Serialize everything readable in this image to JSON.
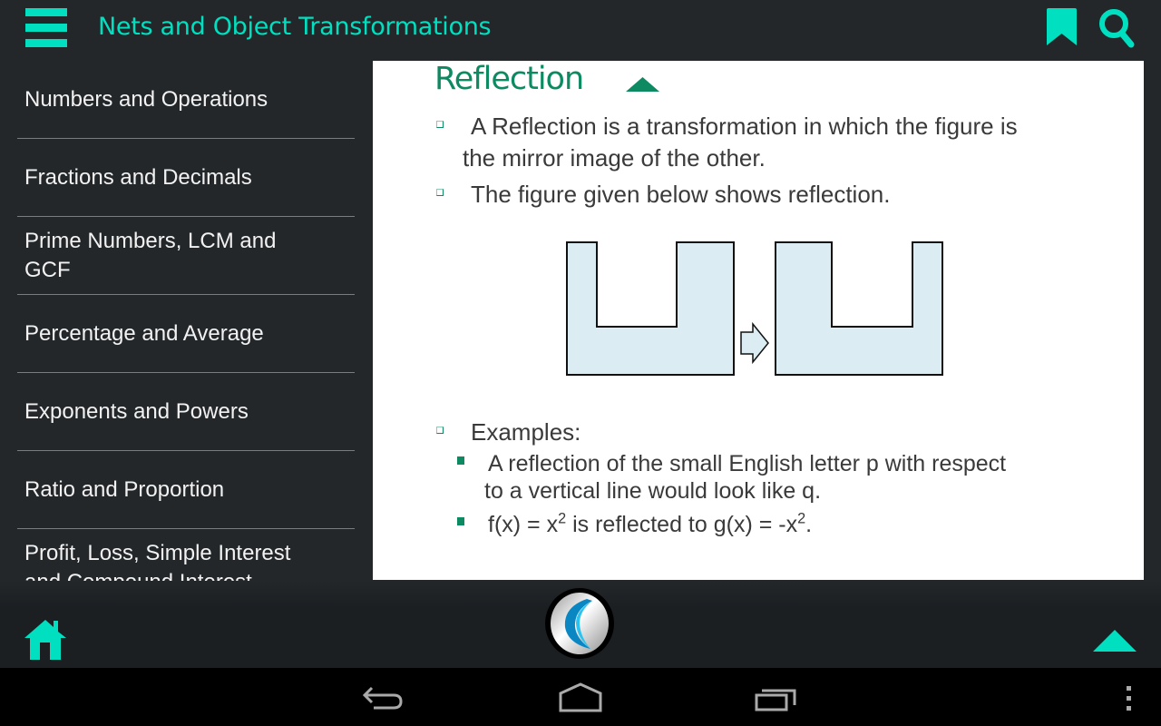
{
  "app_bar": {
    "title": "Nets and Object Transformations",
    "icons": [
      "menu-icon",
      "bookmark-icon",
      "search-icon"
    ],
    "accent_color": "#00e0c0"
  },
  "sidebar": {
    "items": [
      {
        "label": "Numbers and Operations"
      },
      {
        "label": "Fractions and Decimals"
      },
      {
        "label": "Prime Numbers, LCM and GCF"
      },
      {
        "label": "Percentage and Average"
      },
      {
        "label": "Exponents and Powers"
      },
      {
        "label": "Ratio and Proportion"
      },
      {
        "label": "Profit, Loss, Simple Interest and Compound Interest"
      }
    ]
  },
  "content": {
    "section_title": "Reflection",
    "title_color": "#0e8a62",
    "bullets": [
      {
        "line1": "A Reflection is a transformation in which the figure is",
        "line2": "the mirror image of the other."
      },
      {
        "line1": "The figure given below shows reflection."
      },
      {
        "line1": "Examples:"
      }
    ],
    "examples": [
      {
        "line1": "A reflection of the small English letter p with respect",
        "line2": "to a vertical line would look like q."
      },
      {
        "prefix": "f(x) = x",
        "sup1": "2",
        "middle": " is reflected to g(x) = -x",
        "sup2": "2",
        "suffix": "."
      }
    ],
    "figure": {
      "description": "U-shaped figure and its mirror reflection with arrow between",
      "fill_color": "#dbedf3"
    }
  },
  "bottom_bar": {
    "icons": [
      "home-icon",
      "app-logo-icon",
      "scroll-top-icon"
    ]
  },
  "system_nav": {
    "icons": [
      "back-icon",
      "home-outline-icon",
      "recent-apps-icon",
      "overflow-menu-icon"
    ]
  }
}
